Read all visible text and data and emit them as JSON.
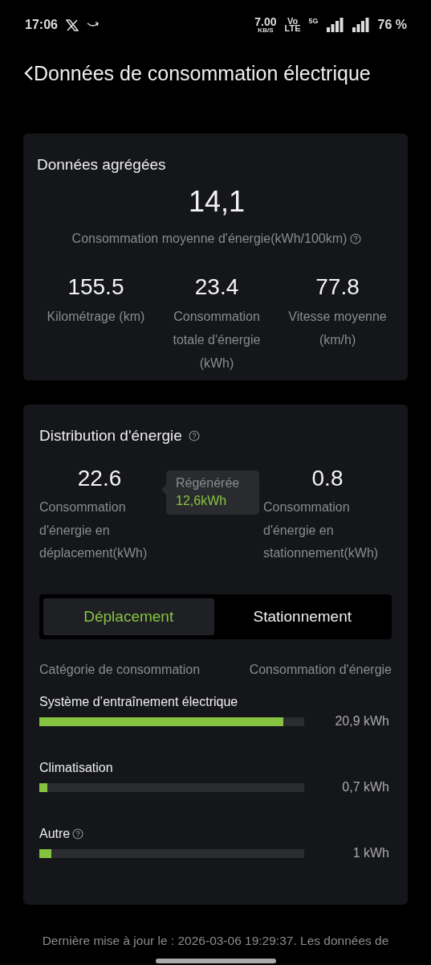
{
  "status_bar": {
    "time": "17:06",
    "speed": "7.00",
    "speed_unit": "KB/S",
    "volte_top": "Vo",
    "volte_bottom": "LTE",
    "network": "5G",
    "battery": "76 %"
  },
  "header": {
    "title": "Données de consommation électrique"
  },
  "aggregate": {
    "title": "Données agrégées",
    "main_value": "14,1",
    "main_label": "Consommation moyenne d'énergie(kWh/100km)",
    "stats": [
      {
        "value": "155.5",
        "label": "Kilométrage (km)"
      },
      {
        "value": "23.4",
        "label": "Consommation totale d'énergie (kWh)"
      },
      {
        "value": "77.8",
        "label": "Vitesse moyenne (km/h)"
      }
    ]
  },
  "distribution": {
    "title": "Distribution d'énergie",
    "driving": {
      "value": "22.6",
      "label": "Consommation d'énergie en déplacement(kWh)"
    },
    "tooltip": {
      "title": "Régénérée",
      "value": "12,6kWh"
    },
    "parking": {
      "value": "0.8",
      "label": "Consommation d'énergie en stationnement(kWh)"
    },
    "tabs": [
      {
        "label": "Déplacement",
        "selected": true
      },
      {
        "label": "Stationnement",
        "selected": false
      }
    ],
    "columns": [
      "Catégorie de consommation",
      "Consommation d'énergie"
    ],
    "rows": [
      {
        "name": "Système d’entraînement électrique",
        "help": false,
        "level": 0.92,
        "reading": "20,9 kWh"
      },
      {
        "name": "Climatisation",
        "help": false,
        "level": 0.03,
        "reading": "0,7 kWh"
      },
      {
        "name": "Autre",
        "help": true,
        "level": 0.045,
        "reading": "1 kWh"
      }
    ]
  },
  "footer": "Dernière mise à jour le : 2026-03-06 19:29:37. Les données de"
}
